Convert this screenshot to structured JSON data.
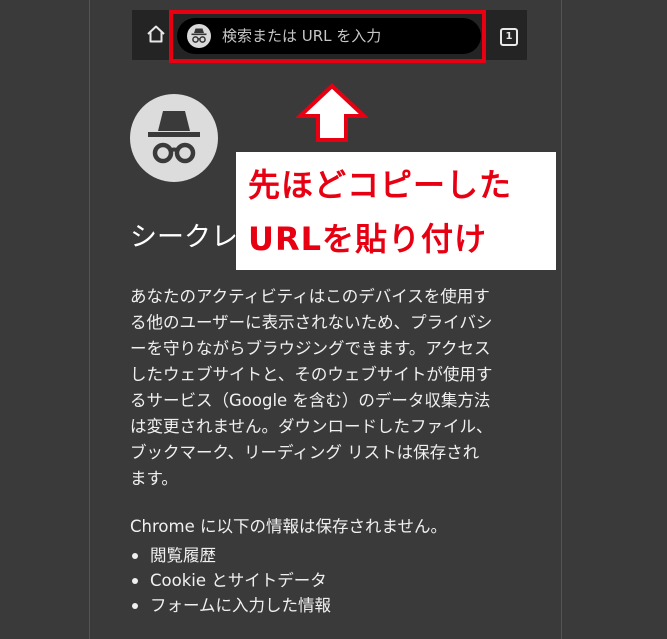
{
  "toolbar": {
    "home_icon": "home-icon",
    "omnibox_icon": "incognito-icon",
    "omnibox_placeholder": "検索または URL を入力",
    "tab_count": "1"
  },
  "annotation": {
    "line1": "先ほどコピーした",
    "line2": "URLを貼り付け",
    "highlight_color": "#e60012"
  },
  "incognito": {
    "icon": "incognito-icon",
    "heading": "シークレ"
  },
  "description_lines": [
    "あなたのアクティビティはこのデバイスを使用す",
    "る他のユーザーに表示されないため、プライバシ",
    "ーを守りながらブラウジングできます。アクセス",
    "したウェブサイトと、そのウェブサイトが使用す",
    "るサービス（Google を含む）のデータ収集方法",
    "は変更されません。ダウンロードしたファイル、",
    "ブックマーク、リーディング リストは保存され",
    "ます。"
  ],
  "info_heading": "Chrome に以下の情報は保存されません。",
  "not_saved": [
    "閲覧履歴",
    "Cookie とサイトデータ",
    "フォームに入力した情報"
  ]
}
